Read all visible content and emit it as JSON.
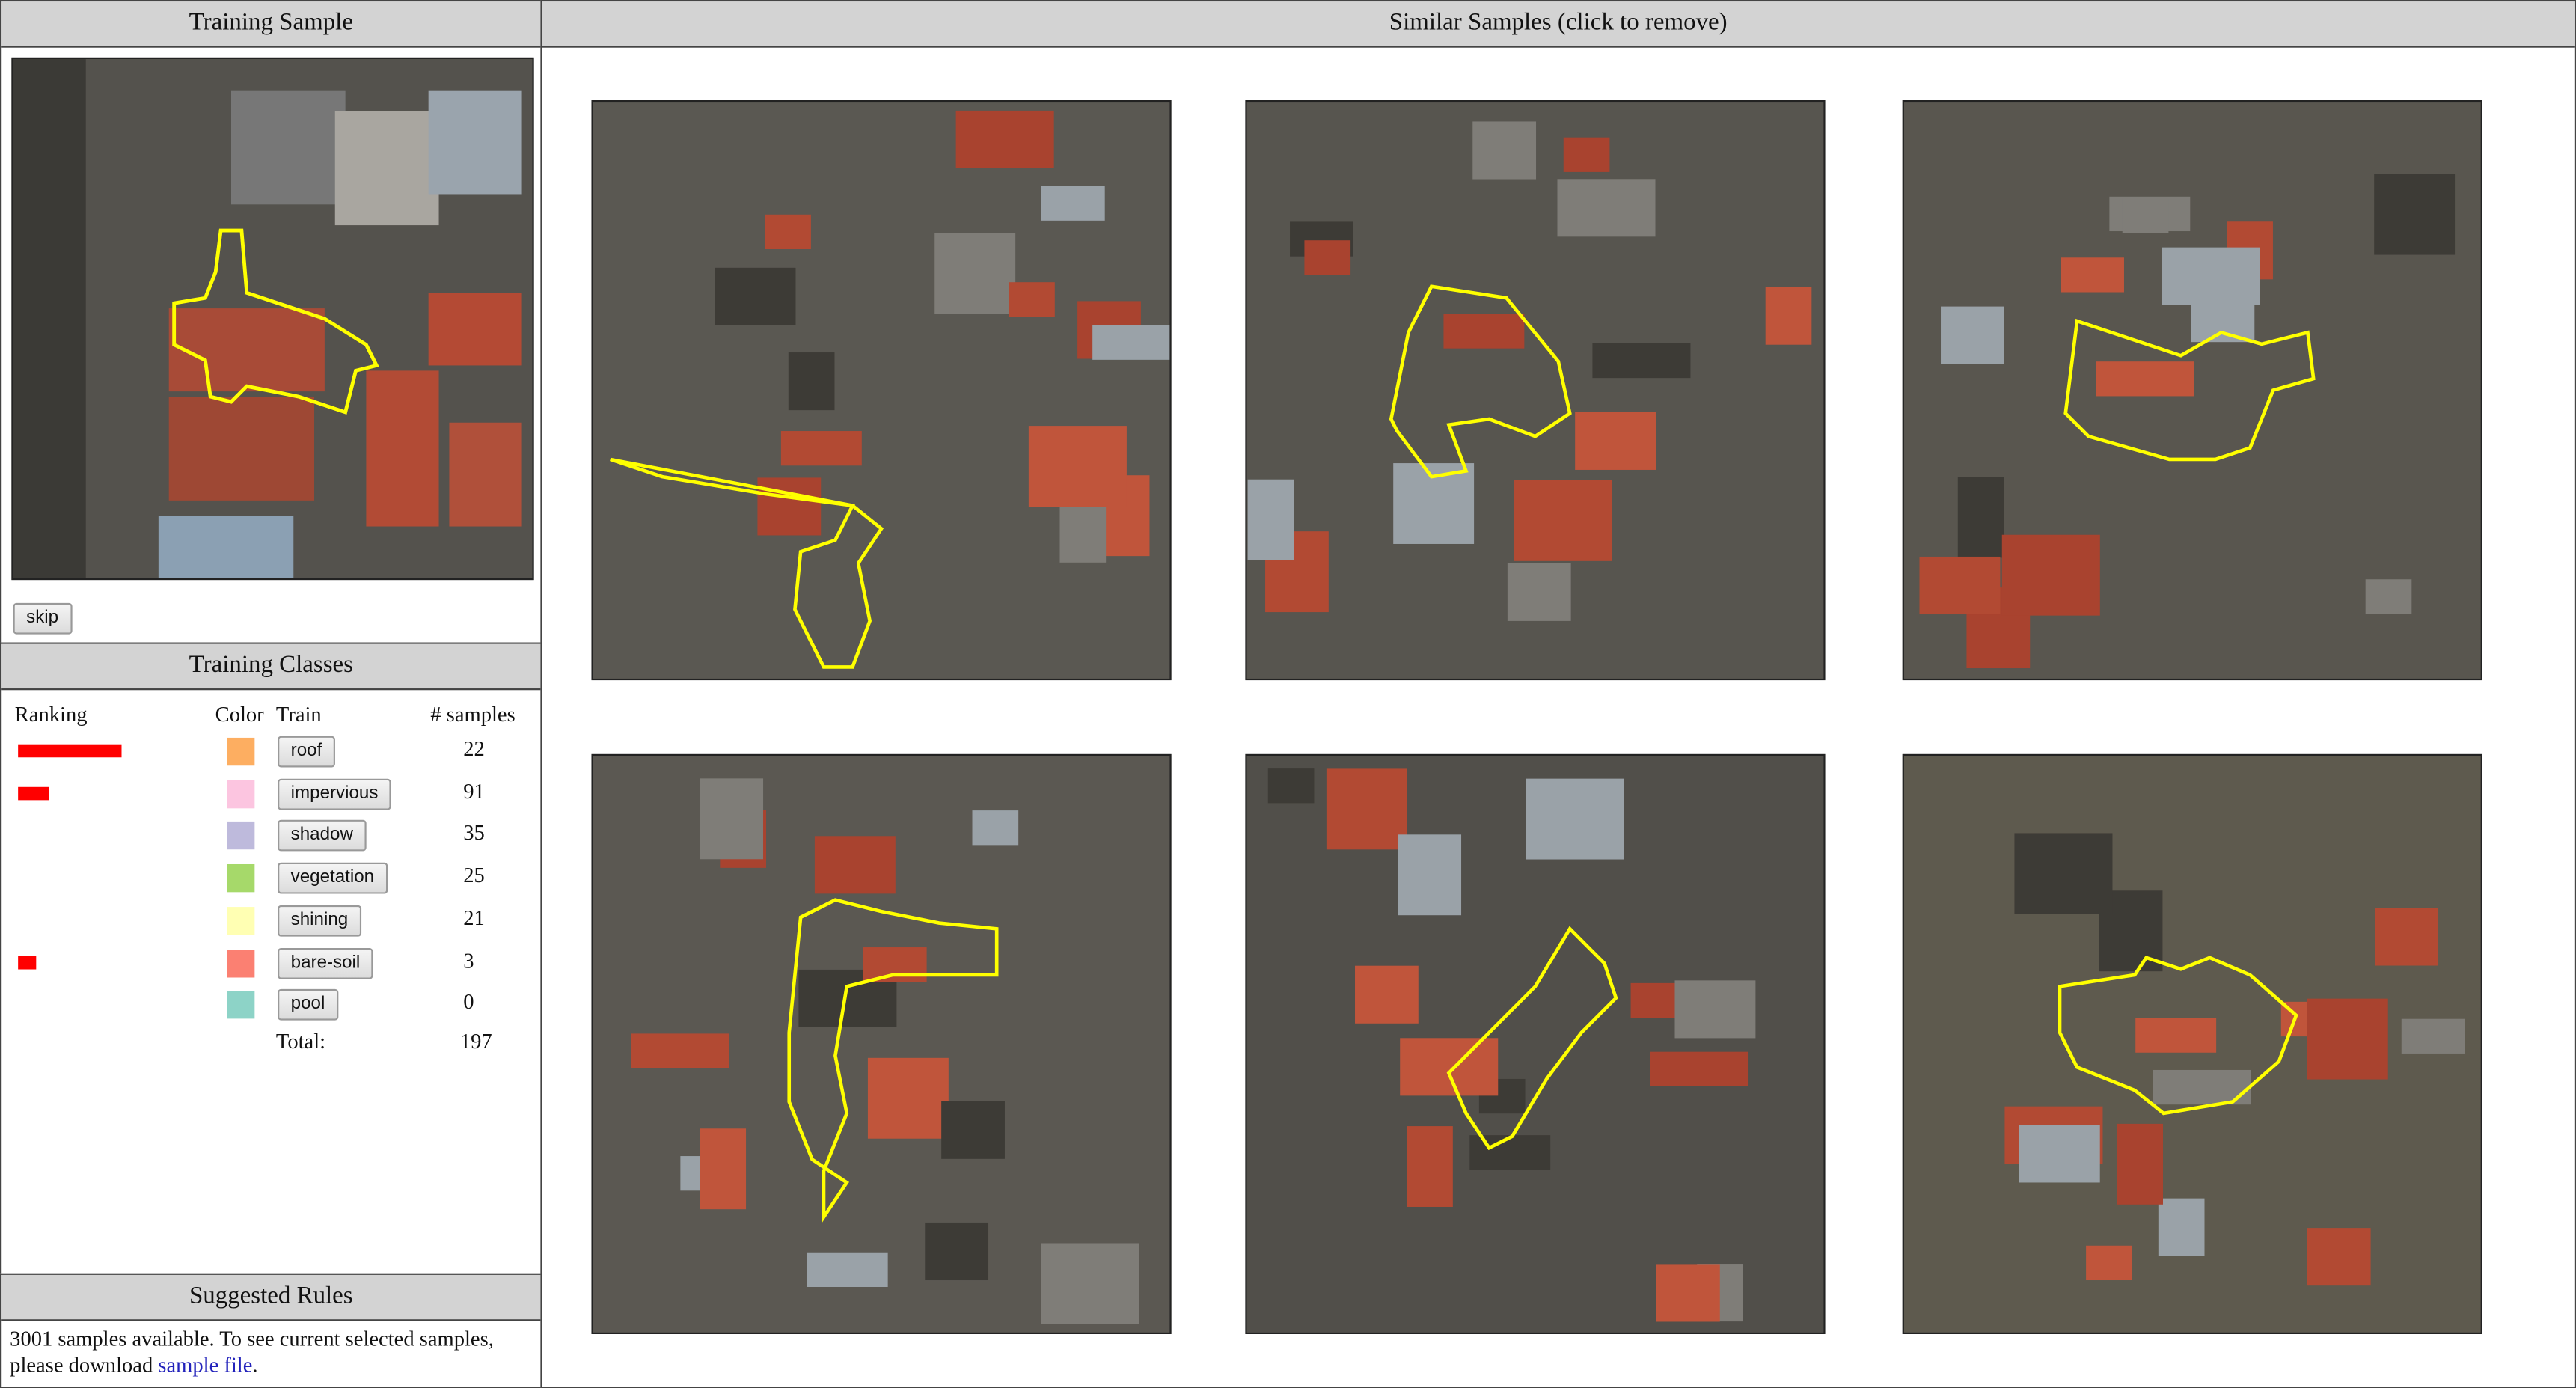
{
  "left": {
    "training_sample": {
      "title": "Training Sample",
      "skip_label": "skip"
    },
    "training_classes": {
      "title": "Training Classes",
      "headers": {
        "ranking": "Ranking",
        "color": "Color",
        "train": "Train",
        "samples": "# samples"
      },
      "classes": [
        {
          "name": "roof",
          "color": "#fdae61",
          "samples": "22",
          "ranking": 1.0
        },
        {
          "name": "impervious",
          "color": "#fcc5e0",
          "samples": "91",
          "ranking": 0.3
        },
        {
          "name": "shadow",
          "color": "#bebadc",
          "samples": "35",
          "ranking": 0
        },
        {
          "name": "vegetation",
          "color": "#a6d96a",
          "samples": "25",
          "ranking": 0
        },
        {
          "name": "shining",
          "color": "#ffffb3",
          "samples": "21",
          "ranking": 0
        },
        {
          "name": "bare-soil",
          "color": "#fb8072",
          "samples": "3",
          "ranking": 0.17
        },
        {
          "name": "pool",
          "color": "#8dd3c7",
          "samples": "0",
          "ranking": 0
        }
      ],
      "total_label": "Total:",
      "total": "197"
    },
    "suggested_rules": {
      "title": "Suggested Rules",
      "text": "3001 samples available. To see current selected samples, please download ",
      "link": "sample file",
      "suffix": "."
    }
  },
  "right": {
    "title": "Similar Samples (click to remove)"
  }
}
